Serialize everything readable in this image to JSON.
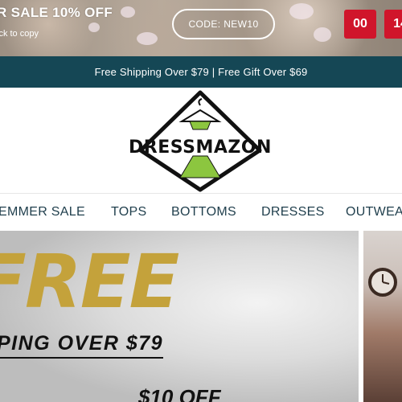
{
  "promo": {
    "title": "R SALE 10% OFF",
    "subtitle": "ick to copy",
    "code": "CODE: NEW10",
    "countdown": [
      "00",
      "14"
    ]
  },
  "shipping_bar": {
    "text": "Free Shipping Over $79  |  Free Gift Over $69"
  },
  "logo": {
    "text": "DRESSMAZON",
    "colors": {
      "accent": "#8cc63f",
      "outline": "#111111"
    }
  },
  "nav": {
    "items": [
      "EMMER SALE",
      "TOPS",
      "BOTTOMS",
      "DRESSES",
      "OUTWEA"
    ]
  },
  "hero": {
    "headline": "FREE",
    "line1": "PING OVER $79",
    "line2": "$10 OFF"
  },
  "colors": {
    "top_bar": "#154755",
    "timer": "#d0152b",
    "nav_text": "#1f3e4c",
    "gold": "#c4a23b"
  }
}
